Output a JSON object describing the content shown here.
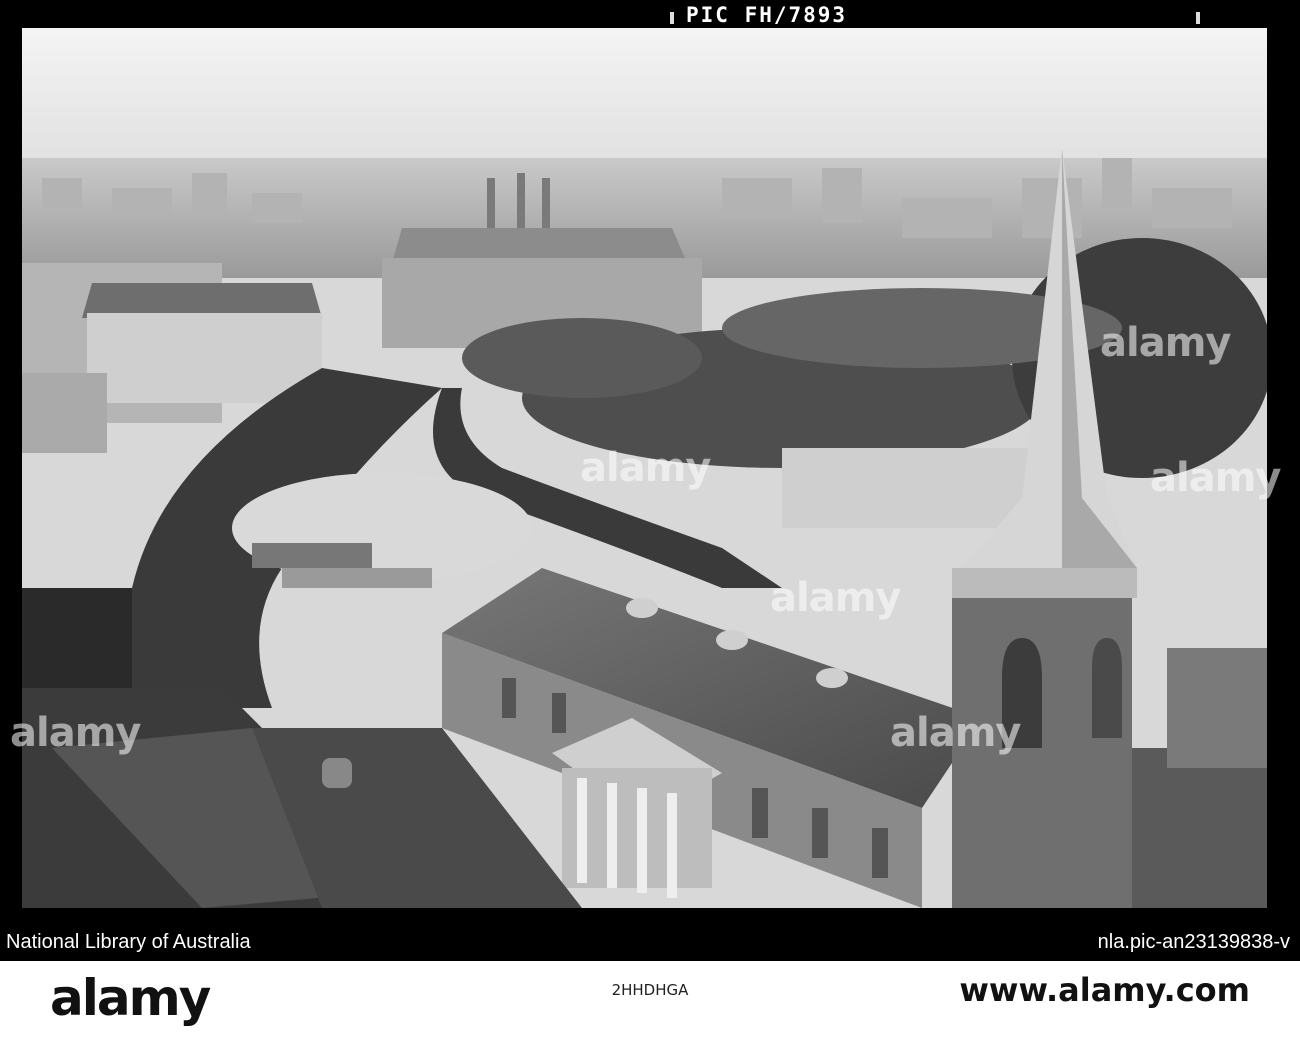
{
  "negative": {
    "label": "PIC FH/7893"
  },
  "caption": {
    "left": "National Library of Australia",
    "right": "nla.pic-an23139838-v"
  },
  "footer": {
    "logo": "alamy",
    "image_id": "2HHDHGA",
    "url": "www.alamy.com"
  },
  "watermarks": [
    "alamy",
    "alamy",
    "alamy",
    "alamy",
    "alamy",
    "alamy"
  ]
}
